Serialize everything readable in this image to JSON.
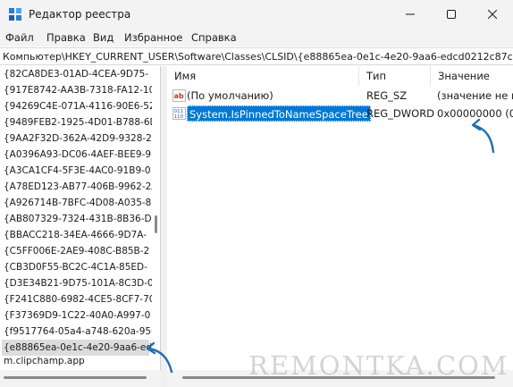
{
  "window": {
    "title": "Редактор реестра",
    "icon": "registry-editor-icon",
    "controls": [
      "minimize-icon",
      "maximize-icon",
      "close-icon"
    ]
  },
  "menu": [
    {
      "label": "Файл"
    },
    {
      "label": "Правка"
    },
    {
      "label": "Вид"
    },
    {
      "label": "Избранное"
    },
    {
      "label": "Справка"
    }
  ],
  "address": "Компьютер\\HKEY_CURRENT_USER\\Software\\Classes\\CLSID\\{e88865ea-0e1c-4e20-9aa6-edcd0212c87c}",
  "tree": {
    "items": [
      "{82CA8DE3-01AD-4CEA-9D75-",
      "{917E8742-AA3B-7318-FA12-10",
      "{94269C4E-071A-4116-90E6-52",
      "{9489FEB2-1925-4D01-B788-6D",
      "{9AA2F32D-362A-42D9-9328-2",
      "{A0396A93-DC06-4AEF-BEE9-9",
      "{A3CA1CF4-5F3E-4AC0-91B9-0",
      "{A78ED123-AB77-406B-9962-2A",
      "{A926714B-7BFC-4D08-A035-8",
      "{AB807329-7324-431B-8B36-DI",
      "{BBACC218-34EA-4666-9D7A-",
      "{C5FF006E-2AE9-408C-B85B-2",
      "{CB3D0F55-BC2C-4C1A-85ED-",
      "{D3E34B21-9D75-101A-8C3D-0",
      "{F241C880-6982-4CE5-8CF7-70",
      "{F37369D9-1C22-40A0-A997-0",
      "{f9517764-05a4-a748-620a-950",
      "{e88865ea-0e1c-4e20-9aa6-edc"
    ],
    "selected_index": 17,
    "partial_item": "m.clipchamp.app"
  },
  "values_table": {
    "columns": {
      "name": "Имя",
      "type": "Тип",
      "data": "Значение"
    },
    "rows": [
      {
        "name": "(По умолчанию)",
        "type": "REG_SZ",
        "data": "(значение не п",
        "icon": "string-value-icon"
      },
      {
        "name": "System.IsPinnedToNameSpaceTree",
        "type": "REG_DWORD",
        "data": "0x00000000 (0)",
        "icon": "dword-value-icon",
        "selected": true
      }
    ]
  },
  "watermark": "REMONTKA.COM",
  "colors": {
    "selection": "#0078d7",
    "annotation_arrow": "#1e6fb5"
  }
}
